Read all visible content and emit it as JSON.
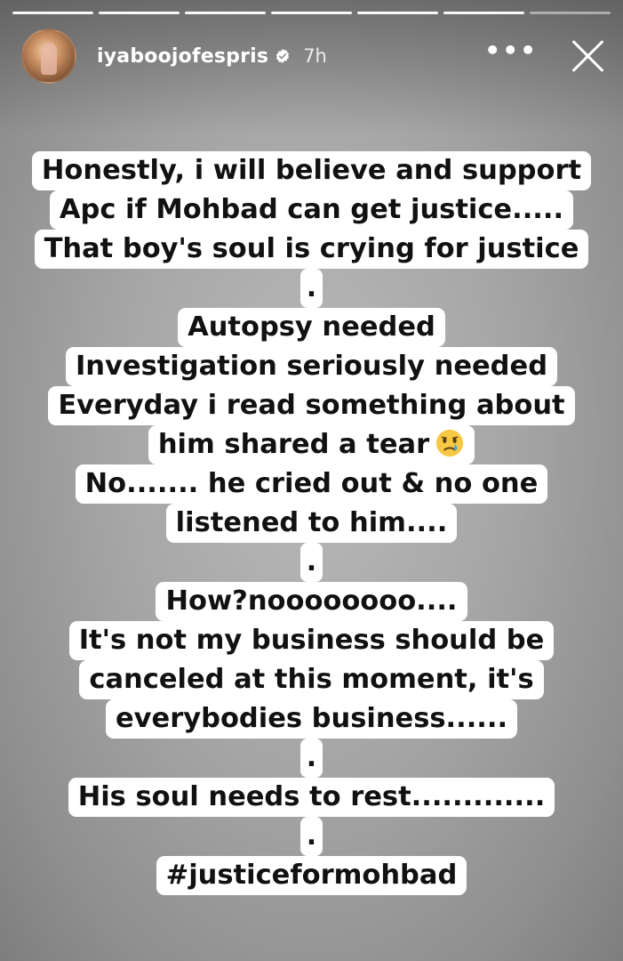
{
  "progress": {
    "segments": 7,
    "active_index": 6
  },
  "header": {
    "username": "iyaboojofespris",
    "verified_icon": "verified-badge-icon",
    "time": "7h",
    "more_label": "•••",
    "close_icon": "close-icon"
  },
  "story": {
    "lines": [
      "Honestly, i will believe and support",
      "Apc if Mohbad can get justice.....",
      "That boy's soul is crying for justice",
      ".",
      "Autopsy needed",
      "Investigation seriously needed",
      "Everyday i read something about",
      "him shared a tear",
      "No....... he cried out & no one",
      "listened to him....",
      ".",
      "How?noooooooo....",
      "It's not my business should be",
      "canceled at this moment, it's",
      "everybodies business......",
      ".",
      "His soul needs to rest.............",
      ".",
      "#justiceformohbad"
    ],
    "emoji": "crying-face-emoji"
  },
  "colors": {
    "background": "#a6a6a6",
    "text_bg": "#ffffff",
    "text": "#111111"
  }
}
